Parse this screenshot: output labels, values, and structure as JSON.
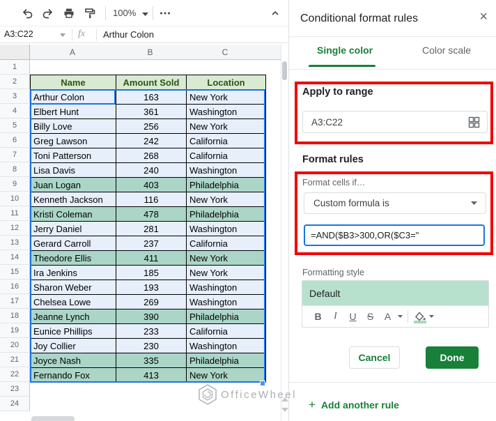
{
  "toolbar": {
    "zoom_value": "100%",
    "icons": [
      "undo-icon",
      "redo-icon",
      "print-icon",
      "paint-format-icon",
      "more-icon",
      "collapse-icon"
    ]
  },
  "formula_bar": {
    "name_box": "A3:C22",
    "fx": "fx",
    "value": "Arthur Colon"
  },
  "sheet": {
    "col_letters": [
      "A",
      "B",
      "C",
      ""
    ],
    "row_count": 24,
    "header_row": {
      "number": 2,
      "cells": [
        "Name",
        "Amount Sold",
        "Location"
      ]
    },
    "rows": [
      {
        "n": 3,
        "name": "Arthur Colon",
        "amount": "163",
        "location": "New York",
        "hl": false
      },
      {
        "n": 4,
        "name": "Elbert Hunt",
        "amount": "361",
        "location": "Washington",
        "hl": false
      },
      {
        "n": 5,
        "name": "Billy Love",
        "amount": "256",
        "location": "New York",
        "hl": false
      },
      {
        "n": 6,
        "name": "Greg Lawson",
        "amount": "242",
        "location": "California",
        "hl": false
      },
      {
        "n": 7,
        "name": "Toni Patterson",
        "amount": "268",
        "location": "California",
        "hl": false
      },
      {
        "n": 8,
        "name": "Lisa Davis",
        "amount": "240",
        "location": "Washington",
        "hl": false
      },
      {
        "n": 9,
        "name": "Juan Logan",
        "amount": "403",
        "location": "Philadelphia",
        "hl": true
      },
      {
        "n": 10,
        "name": "Kenneth Jackson",
        "amount": "116",
        "location": "New York",
        "hl": false
      },
      {
        "n": 11,
        "name": "Kristi Coleman",
        "amount": "478",
        "location": "Philadelphia",
        "hl": true
      },
      {
        "n": 12,
        "name": "Jerry Daniel",
        "amount": "281",
        "location": "Washington",
        "hl": false
      },
      {
        "n": 13,
        "name": "Gerard Carroll",
        "amount": "237",
        "location": "California",
        "hl": false
      },
      {
        "n": 14,
        "name": "Theodore Ellis",
        "amount": "411",
        "location": "New York",
        "hl": true
      },
      {
        "n": 15,
        "name": "Ira Jenkins",
        "amount": "185",
        "location": "New York",
        "hl": false
      },
      {
        "n": 16,
        "name": "Sharon Weber",
        "amount": "193",
        "location": "Washington",
        "hl": false
      },
      {
        "n": 17,
        "name": "Chelsea Lowe",
        "amount": "269",
        "location": "Washington",
        "hl": false
      },
      {
        "n": 18,
        "name": "Jeanne Lynch",
        "amount": "390",
        "location": "Philadelphia",
        "hl": true
      },
      {
        "n": 19,
        "name": "Eunice Phillips",
        "amount": "233",
        "location": "California",
        "hl": false
      },
      {
        "n": 20,
        "name": "Joy Collier",
        "amount": "230",
        "location": "Washington",
        "hl": false
      },
      {
        "n": 21,
        "name": "Joyce Nash",
        "amount": "335",
        "location": "Philadelphia",
        "hl": true
      },
      {
        "n": 22,
        "name": "Fernando Fox",
        "amount": "413",
        "location": "New York",
        "hl": true
      }
    ]
  },
  "panel": {
    "title": "Conditional format rules",
    "close_icon": "×",
    "tabs": {
      "single_color": "Single color",
      "color_scale": "Color scale"
    },
    "apply_to_range": {
      "label": "Apply to range",
      "value": "A3:C22"
    },
    "format_rules": {
      "label": "Format rules",
      "condition_label": "Format cells if…",
      "condition_value": "Custom formula is",
      "formula": "=AND($B3>300,OR($C3=\""
    },
    "formatting_style": {
      "label": "Formatting style",
      "preview_text": "Default",
      "bold": "B",
      "italic": "I",
      "underline": "U",
      "strike": "S",
      "text_color": "A"
    },
    "buttons": {
      "cancel": "Cancel",
      "done": "Done"
    },
    "add_rule": {
      "plus": "+",
      "label": "Add another rule"
    }
  },
  "watermark": {
    "text": "OfficeWheel"
  },
  "colors": {
    "accent_green": "#188038",
    "selection_blue": "#1a73e8",
    "annotation_red": "#f20000",
    "table_header_bg": "#d9ead3",
    "table_header_text": "#2b5514",
    "row_blue": "#e7effb",
    "row_teal": "#abd6c7",
    "preview_green": "#b7e1cd"
  }
}
